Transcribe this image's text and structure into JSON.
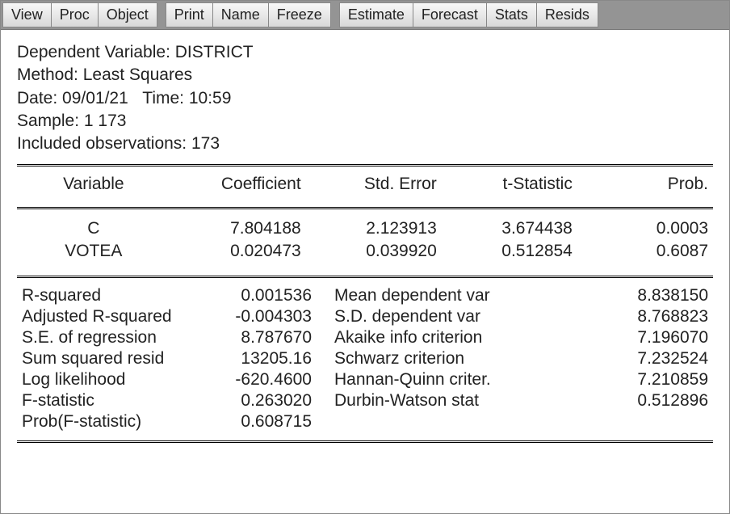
{
  "toolbar": {
    "groups": [
      [
        "View",
        "Proc",
        "Object"
      ],
      [
        "Print",
        "Name",
        "Freeze"
      ],
      [
        "Estimate",
        "Forecast",
        "Stats",
        "Resids"
      ]
    ]
  },
  "header": {
    "dep_var_label": "Dependent Variable: ",
    "dep_var": "DISTRICT",
    "method_label": "Method: ",
    "method": "Least Squares",
    "date_label": "Date: ",
    "date": "09/01/21",
    "time_label": "Time: ",
    "time": "10:59",
    "sample_label": "Sample: ",
    "sample": "1 173",
    "obs_label": "Included observations: ",
    "obs": "173"
  },
  "coef_table": {
    "headers": {
      "variable": "Variable",
      "coefficient": "Coefficient",
      "stderr": "Std. Error",
      "tstat": "t-Statistic",
      "prob": "Prob.  "
    },
    "rows": [
      {
        "var": "C",
        "coef": "7.804188",
        "se": "2.123913",
        "t": "3.674438",
        "p": "0.0003"
      },
      {
        "var": "VOTEA",
        "coef": "0.020473",
        "se": "0.039920",
        "t": "0.512854",
        "p": "0.6087"
      }
    ]
  },
  "stats": {
    "left": [
      {
        "label": "R-squared",
        "value": "0.001536"
      },
      {
        "label": "Adjusted R-squared",
        "value": "-0.004303"
      },
      {
        "label": "S.E. of regression",
        "value": "8.787670"
      },
      {
        "label": "Sum squared resid",
        "value": "13205.16"
      },
      {
        "label": "Log likelihood",
        "value": "-620.4600"
      },
      {
        "label": "F-statistic",
        "value": "0.263020"
      },
      {
        "label": "Prob(F-statistic)",
        "value": "0.608715"
      }
    ],
    "right": [
      {
        "label": "Mean dependent var",
        "value": "8.838150"
      },
      {
        "label": "S.D. dependent var",
        "value": "8.768823"
      },
      {
        "label": "Akaike info criterion",
        "value": "7.196070"
      },
      {
        "label": "Schwarz criterion",
        "value": "7.232524"
      },
      {
        "label": "Hannan-Quinn criter.",
        "value": "7.210859"
      },
      {
        "label": "Durbin-Watson stat",
        "value": "0.512896"
      },
      {
        "label": "",
        "value": ""
      }
    ]
  }
}
